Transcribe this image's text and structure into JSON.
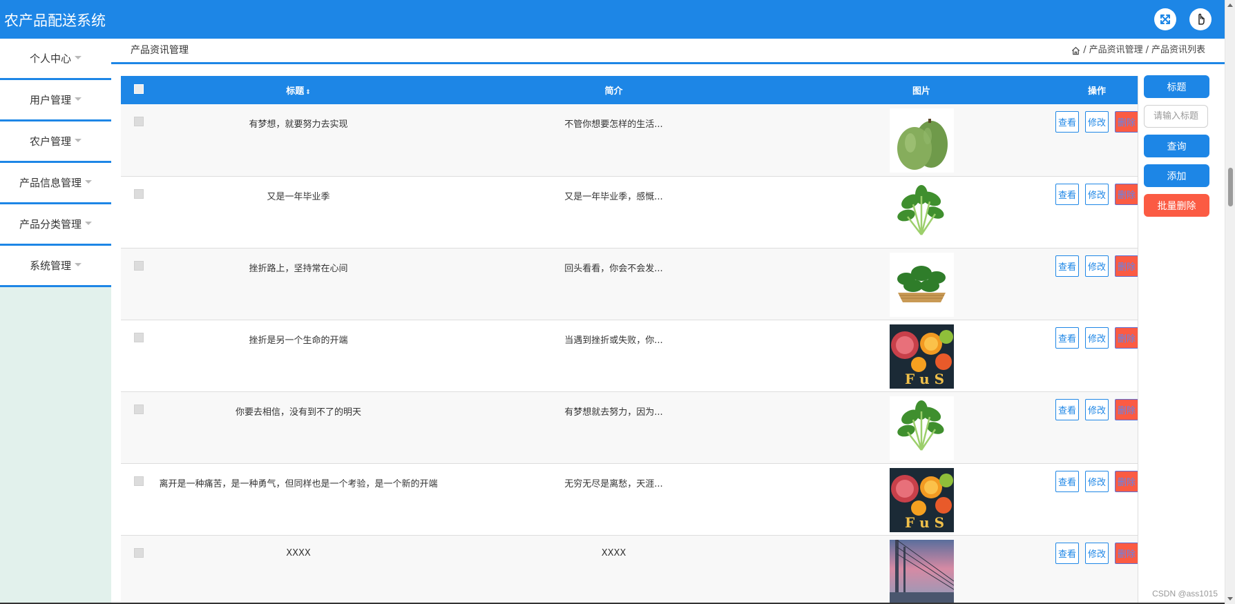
{
  "app": {
    "title": "农产品配送系统"
  },
  "header": {
    "fullscreen_icon": "fullscreen-icon",
    "user_icon": "user-avatar-icon"
  },
  "sidebar": {
    "items": [
      {
        "label": "个人中心"
      },
      {
        "label": "用户管理"
      },
      {
        "label": "农户管理"
      },
      {
        "label": "产品信息管理"
      },
      {
        "label": "产品分类管理"
      },
      {
        "label": "系统管理"
      }
    ]
  },
  "page": {
    "title": "产品资讯管理",
    "breadcrumb": {
      "sep1": "/",
      "level1": "产品资讯管理",
      "sep2": "/",
      "level2": "产品资讯列表"
    }
  },
  "table": {
    "headers": {
      "title": "标题",
      "sort_glyph": "⇕",
      "intro": "简介",
      "image": "图片",
      "ops": "操作"
    },
    "buttons": {
      "view": "查看",
      "edit": "修改",
      "delete": "删除"
    },
    "rows": [
      {
        "title": "有梦想，就要努力去实现",
        "intro": "不管你想要怎样的生活...",
        "image": "winter-melon"
      },
      {
        "title": "又是一年毕业季",
        "intro": "又是一年毕业季，感慨...",
        "image": "spinach"
      },
      {
        "title": "挫折路上，坚持常在心间",
        "intro": "回头看看，你会不会发...",
        "image": "greens-basket"
      },
      {
        "title": "挫折是另一个生命的开端",
        "intro": "当遇到挫折或失败，你...",
        "image": "fruit-poster"
      },
      {
        "title": "你要去相信，没有到不了的明天",
        "intro": "有梦想就去努力，因为...",
        "image": "spinach"
      },
      {
        "title": "离开是一种痛苦，是一种勇气，但同样也是一个考验，是一个新的开端",
        "intro": "无穷无尽是离愁，天涯...",
        "image": "fruit-poster"
      },
      {
        "title": "XXXX",
        "intro": "XXXX",
        "image": "city-bridge"
      }
    ]
  },
  "search": {
    "label": "标题",
    "placeholder": "请输入标题",
    "query_button": "查询",
    "add_button": "添加",
    "batch_delete_button": "批量删除"
  },
  "watermark": "CSDN @ass1015",
  "colors": {
    "primary": "#1d86e6",
    "danger": "#fb5b43",
    "sidebar_bg": "#e2f1ec"
  }
}
